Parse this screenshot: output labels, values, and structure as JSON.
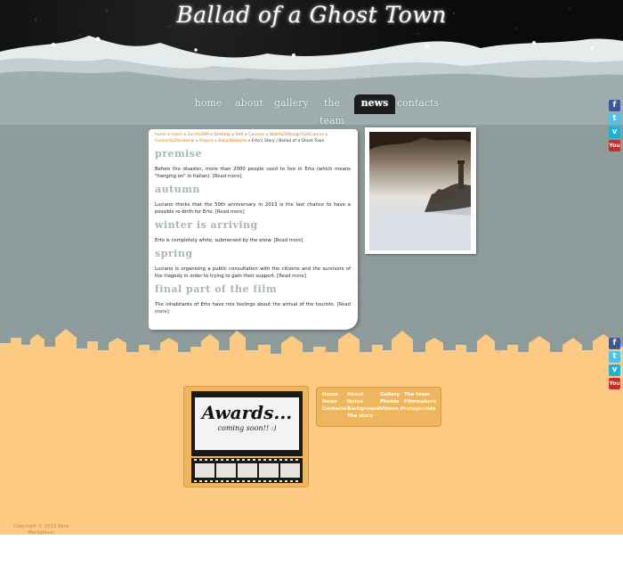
{
  "site": {
    "title": "Ballad of a Ghost Town"
  },
  "nav": {
    "items": [
      {
        "label": "home"
      },
      {
        "label": "about"
      },
      {
        "label": "gallery"
      },
      {
        "label": "the team"
      },
      {
        "label": "news"
      },
      {
        "label": "contacts"
      }
    ],
    "active": "news"
  },
  "social": {
    "icons": [
      "facebook-icon",
      "twitter-icon",
      "vimeo-icon",
      "youtube-icon"
    ],
    "youtube_glyph": "You",
    "facebook_glyph": "f",
    "twitter_glyph": "t",
    "vimeo_glyph": "v"
  },
  "breadcrumb": {
    "links": [
      "home",
      "Users",
      "Sara%20M",
      "Desktop",
      "SitA",
      "Courses",
      "Web%20Design%20Course",
      "Course%20material",
      "Project",
      "BalladWebsite"
    ],
    "separator": "»",
    "current": "Erto's Story | Ballad of a Ghost Town"
  },
  "sections": [
    {
      "title": "premise",
      "text": "Before the disaster, more than 2000 people used to live in Erto (which means \"hanging on\" in Italian).",
      "more": "[Read more]"
    },
    {
      "title": "autumn",
      "text": "Luciano thinks that the 50th anniversary in 2013 is the last chance to have a possible re-birth for Erto.",
      "more": "[Read more]"
    },
    {
      "title": "winter is arriving",
      "text": "Erto is completely white, submersed by the snow.",
      "more": "[Read more]"
    },
    {
      "title": "spring",
      "text": "Luciano is organising a public consultation with the citizens and the survivors of the tragedy in order to trying to gain their support.",
      "more": "[Read more]"
    },
    {
      "title": "final part of the film",
      "text": "The inhabitants of Erto have mix feelings about the arrival of the tourists.",
      "more": "[Read more]"
    }
  ],
  "awards": {
    "title": "Awards...",
    "subtitle": "coming soon!! :)"
  },
  "footer_links": {
    "col1": [
      "Home",
      "News",
      "Contacts"
    ],
    "col2": [
      "About",
      "Notes",
      "Background",
      "The story"
    ],
    "col3": [
      "Gallery",
      "Photos",
      "Videos"
    ],
    "col4": [
      "The team",
      "Filmmakers",
      "Protagonists"
    ]
  },
  "copyright": "Copyright © 2013 Sara Morilghiani",
  "colors": {
    "accent": "#d07a1a",
    "sand": "#fdca83",
    "box": "#f0b65d",
    "sky": "#8d9a9a"
  }
}
